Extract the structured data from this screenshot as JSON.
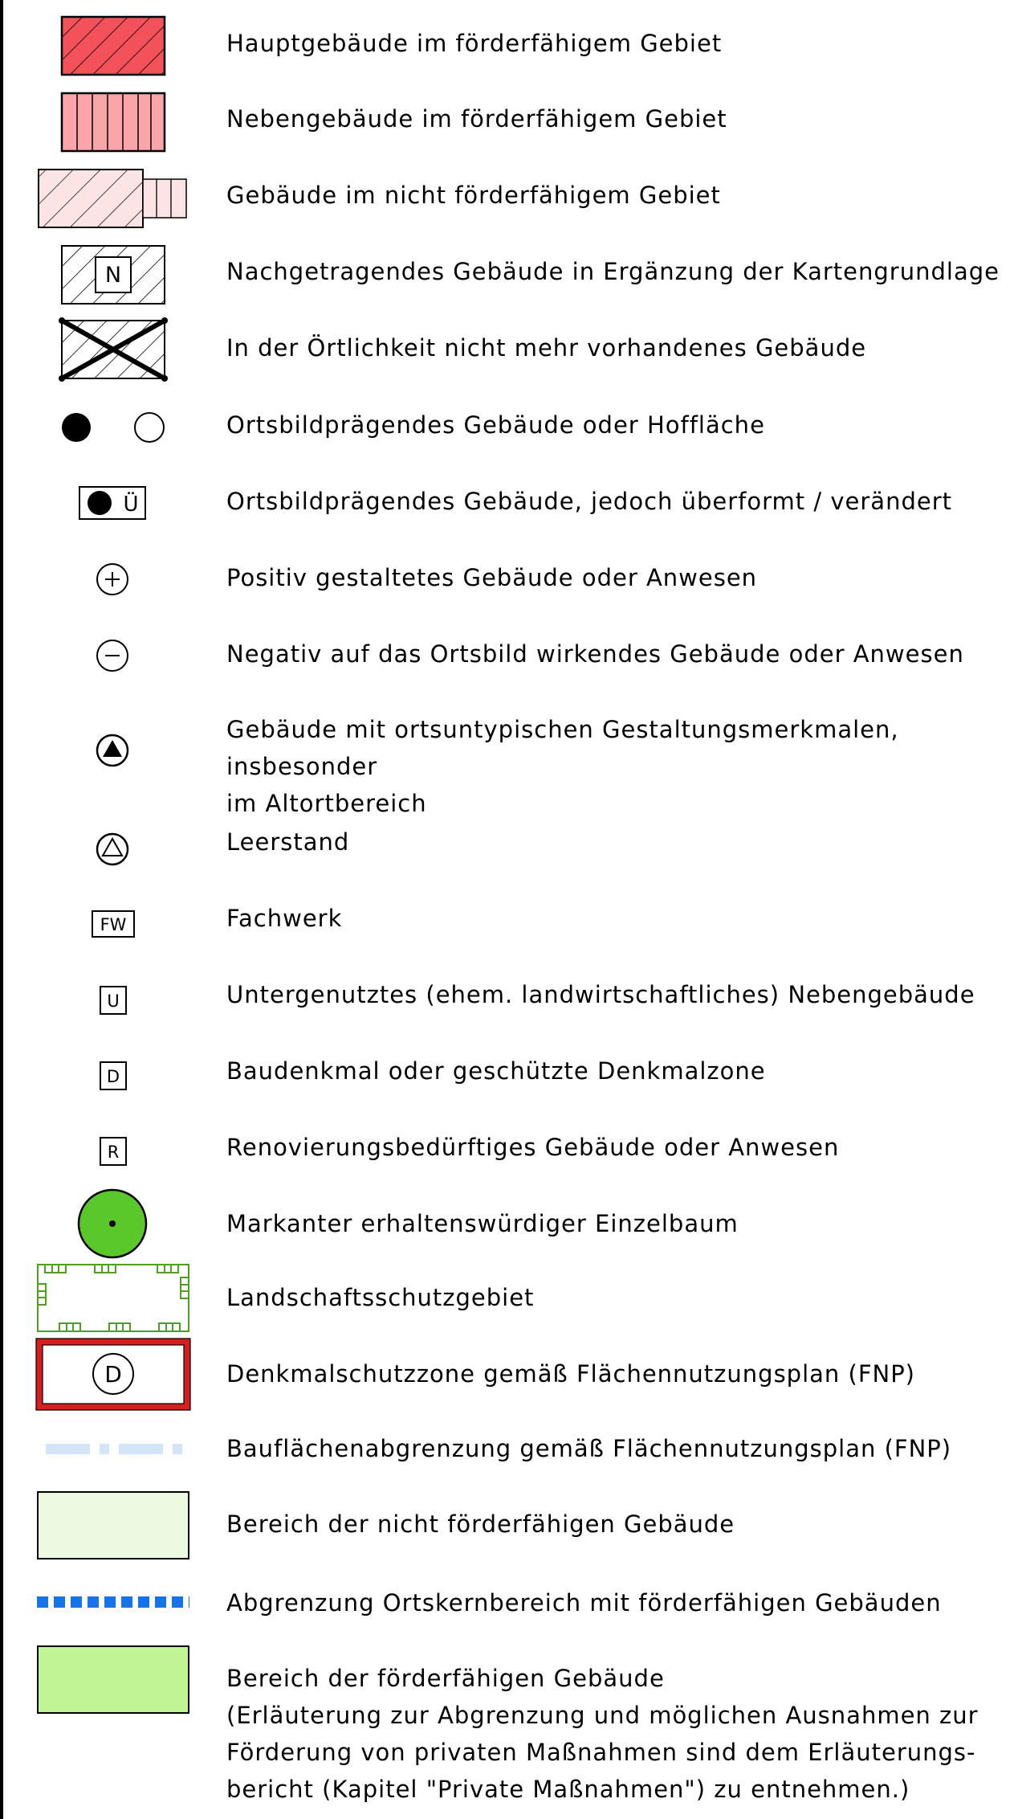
{
  "legend": {
    "items": [
      {
        "id": "hauptgebaeude",
        "label": "Hauptgebäude im förderfähigem Gebiet"
      },
      {
        "id": "nebengebaeude",
        "label": "Nebengebäude im förderfähigem Gebiet"
      },
      {
        "id": "nicht-foerder",
        "label": "Gebäude im nicht förderfähigem Gebiet"
      },
      {
        "id": "nachgetragen",
        "label": "Nachgetragendes Gebäude in Ergänzung der Kartengrundlage",
        "symbol_text": "N"
      },
      {
        "id": "nicht-vorhanden",
        "label": "In der Örtlichkeit nicht mehr vorhandenes Gebäude"
      },
      {
        "id": "ortsbild",
        "label": "Ortsbildprägendes Gebäude oder Hoffläche"
      },
      {
        "id": "ueberformt",
        "label": "Ortsbildprägendes Gebäude, jedoch überformt / verändert",
        "symbol_text": "Ü"
      },
      {
        "id": "positiv",
        "label": "Positiv gestaltetes Gebäude oder Anwesen",
        "symbol_text": "+"
      },
      {
        "id": "negativ",
        "label": "Negativ auf das Ortsbild wirkendes Gebäude oder Anwesen",
        "symbol_text": "−"
      },
      {
        "id": "ortsuntypisch",
        "label": "Gebäude mit ortsuntypischen Gestaltungsmerkmalen, insbesonder\nim Altortbereich"
      },
      {
        "id": "leerstand",
        "label": "Leerstand"
      },
      {
        "id": "fachwerk",
        "label": "Fachwerk",
        "symbol_text": "FW"
      },
      {
        "id": "untergenutzt",
        "label": "Untergenutztes (ehem. landwirtschaftliches) Nebengebäude",
        "symbol_text": "U"
      },
      {
        "id": "baudenkmal",
        "label": "Baudenkmal oder geschützte Denkmalzone",
        "symbol_text": "D"
      },
      {
        "id": "renovierung",
        "label": "Renovierungsbedürftiges Gebäude oder Anwesen",
        "symbol_text": "R"
      },
      {
        "id": "einzelbaum",
        "label": "Markanter erhaltenswürdiger Einzelbaum"
      },
      {
        "id": "landschaftsschutz",
        "label": "Landschaftsschutzgebiet"
      },
      {
        "id": "denkmalschutzzone",
        "label": "Denkmalschutzzone gemäß Flächennutzungsplan (FNP)",
        "symbol_text": "D"
      },
      {
        "id": "bauflaechen",
        "label": "Bauflächenabgrenzung gemäß Flächennutzungsplan (FNP)"
      },
      {
        "id": "bereich-nicht",
        "label": "Bereich der nicht förderfähigen Gebäude"
      },
      {
        "id": "abgrenzung-ortskern",
        "label": "Abgrenzung Ortskernbereich mit förderfähigen Gebäuden"
      },
      {
        "id": "bereich-foerder",
        "label": "Bereich der förderfähigen Gebäude\n(Erläuterung zur Abgrenzung und möglichen Ausnahmen zur\nFörderung von privaten Maßnahmen sind dem Erläuterungs-\nbericht (Kapitel \"Private Maßnahmen\") zu entnehmen.)"
      }
    ]
  },
  "colors": {
    "haupt_fill": "#f4525a",
    "neben_fill": "#f9a5aa",
    "nicht_fill": "#fce4e4",
    "tree_fill": "#5ac82a",
    "landschaft_stroke": "#4ea01e",
    "denkmal_red": "#d62020",
    "fnp_blue_light": "#d3e6f8",
    "ortskern_blue": "#1673e8",
    "bereich_nicht_fill": "#edfae2",
    "bereich_foerder_fill": "#c1f494"
  }
}
